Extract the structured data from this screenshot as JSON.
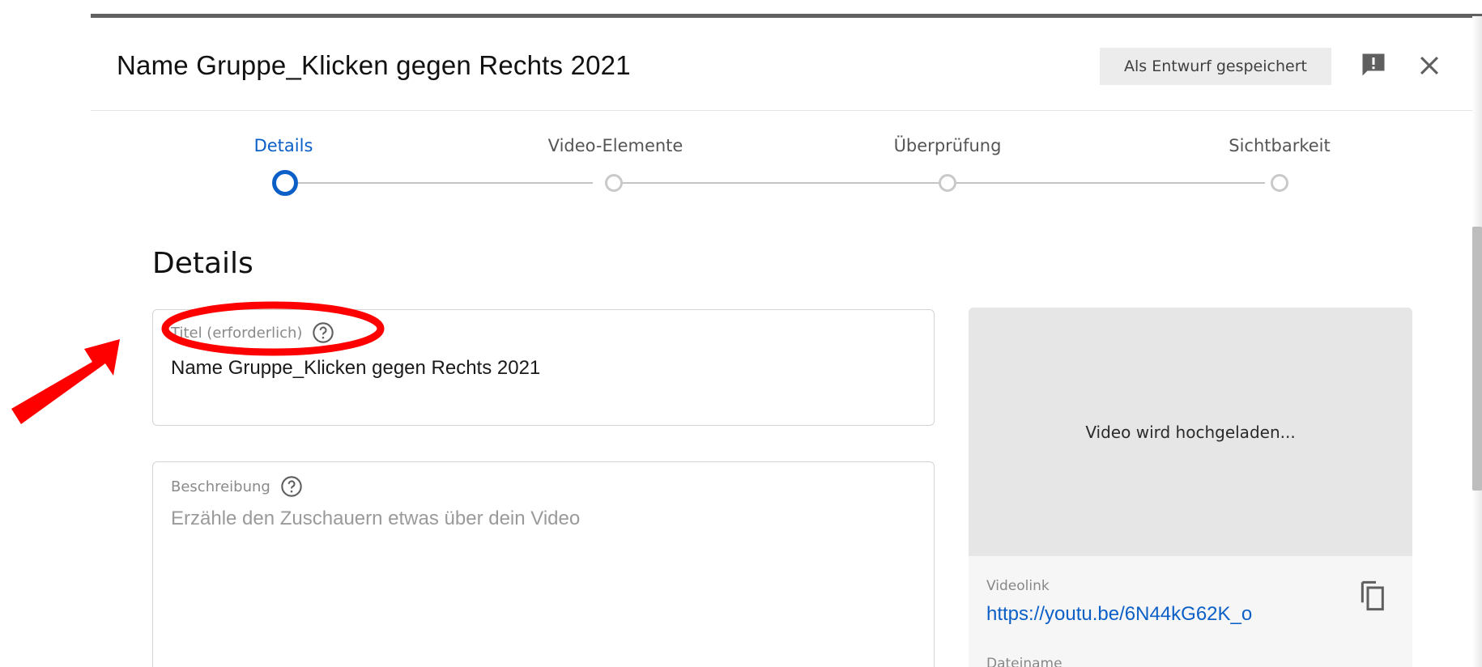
{
  "dialog": {
    "title": "Name Gruppe_Klicken gegen Rechts 2021",
    "draft_status": "Als Entwurf gespeichert"
  },
  "steps": [
    {
      "label": "Details",
      "active": true
    },
    {
      "label": "Video-Elemente",
      "active": false
    },
    {
      "label": "Überprüfung",
      "active": false
    },
    {
      "label": "Sichtbarkeit",
      "active": false
    }
  ],
  "details": {
    "heading": "Details",
    "title_field": {
      "label": "Titel (erforderlich)",
      "value": "Name Gruppe_Klicken gegen Rechts 2021"
    },
    "description_field": {
      "label": "Beschreibung",
      "placeholder": "Erzähle den Zuschauern etwas über dein Video"
    }
  },
  "side_panel": {
    "upload_status": "Video wird hochgeladen...",
    "video_link_label": "Videolink",
    "video_link": "https://youtu.be/6N44kG62K_o",
    "filename_label": "Dateiname"
  },
  "icons": {
    "feedback": "feedback-icon",
    "close": "close-icon",
    "help": "help-icon",
    "copy": "copy-icon"
  },
  "colors": {
    "accent": "#0b5fc6",
    "annotation": "#ff0000",
    "badge_bg": "#ececec"
  }
}
